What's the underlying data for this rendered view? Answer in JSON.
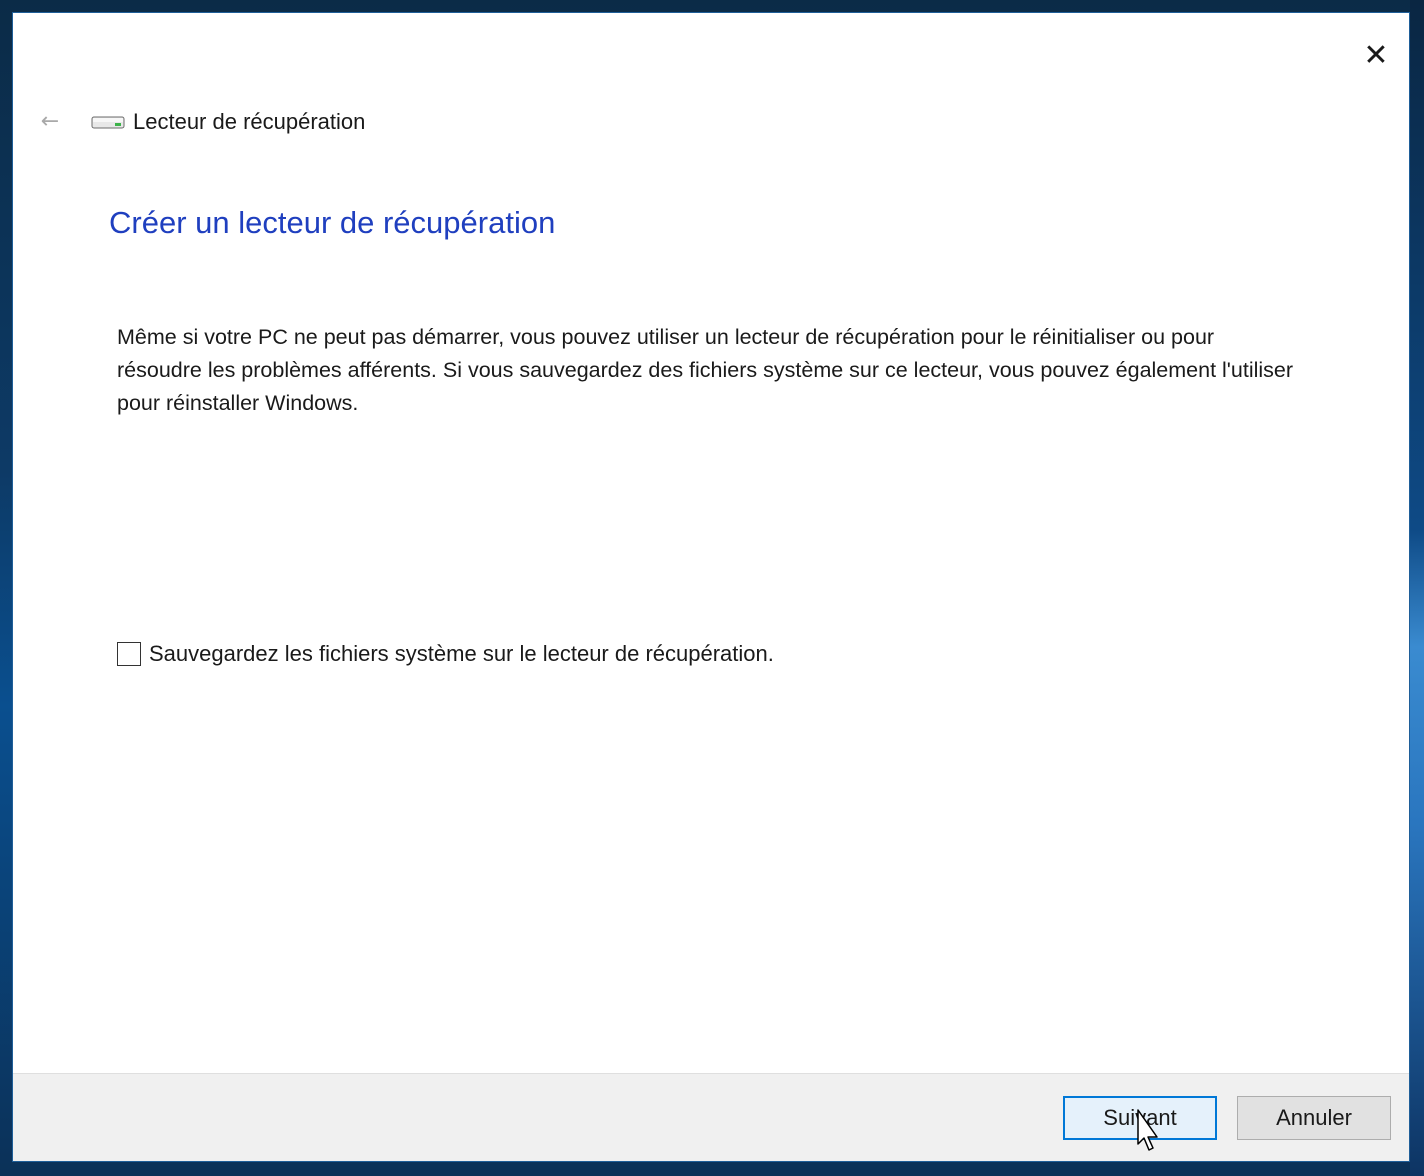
{
  "window": {
    "close_icon": "close-icon",
    "nav": {
      "back_icon": "back-arrow-icon",
      "drive_icon": "drive-icon",
      "title": "Lecteur de récupération"
    }
  },
  "content": {
    "heading": "Créer un lecteur de récupération",
    "description": "Même si votre PC ne peut pas démarrer, vous pouvez utiliser un lecteur de récupération pour le réinitialiser ou pour résoudre les problèmes afférents. Si vous sauvegardez des fichiers système sur ce lecteur, vous pouvez également l'utiliser pour réinstaller Windows.",
    "checkbox": {
      "label": "Sauvegardez les fichiers système sur le lecteur de récupération.",
      "checked": false
    }
  },
  "footer": {
    "next_label": "Suivant",
    "cancel_label": "Annuler"
  },
  "colors": {
    "heading": "#1f3fbf",
    "primary_button_border": "#0078d7",
    "footer_bg": "#f0f0f0"
  }
}
